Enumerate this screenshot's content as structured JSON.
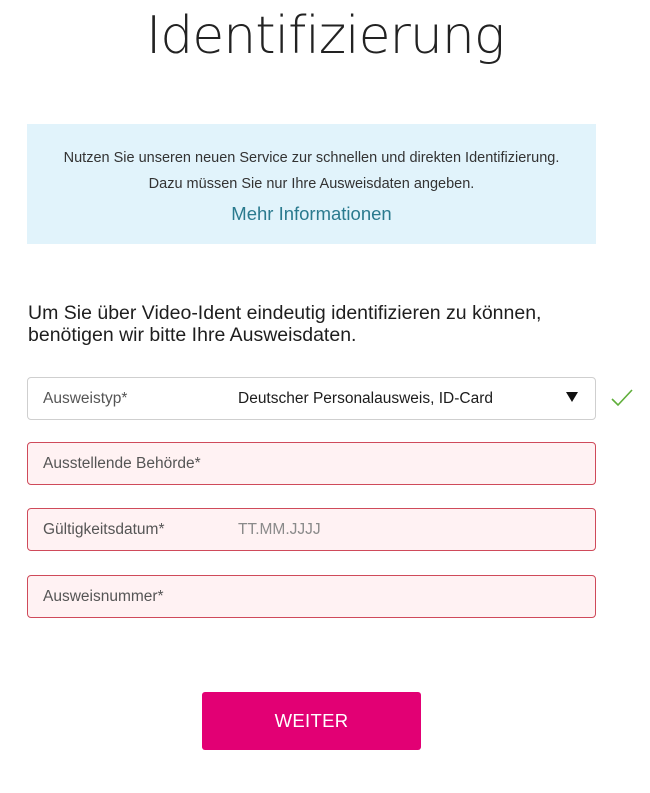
{
  "page": {
    "title": "Identifizierung"
  },
  "info": {
    "line1": "Nutzen Sie unseren neuen Service zur schnellen und direkten Identifizierung.",
    "line2": "Dazu müssen Sie nur Ihre Ausweisdaten angeben.",
    "link": "Mehr Informationen"
  },
  "intro": {
    "text": "Um Sie über Video-Ident eindeutig identifizieren zu können, benötigen wir bitte Ihre Ausweisdaten."
  },
  "form": {
    "id_type": {
      "label": "Ausweistyp*",
      "value": "Deutscher Personalausweis, ID-Card",
      "state": "valid",
      "icon": "chevron-down-icon",
      "status_icon": "checkmark-icon"
    },
    "authority": {
      "label": "Ausstellende Behörde*",
      "value": "",
      "state": "invalid"
    },
    "validity_date": {
      "label": "Gültigkeitsdatum*",
      "placeholder": "TT.MM.JJJJ",
      "value": "",
      "state": "invalid"
    },
    "id_number": {
      "label": "Ausweisnummer*",
      "value": "",
      "state": "invalid"
    },
    "submit_label": "WEITER"
  },
  "colors": {
    "brand_magenta": "#e20074",
    "info_background": "#e1f3fb",
    "link_color": "#2a7a8e",
    "error_border": "#cf4a5a",
    "error_background": "#fff2f3",
    "valid_check": "#5fae3a"
  }
}
